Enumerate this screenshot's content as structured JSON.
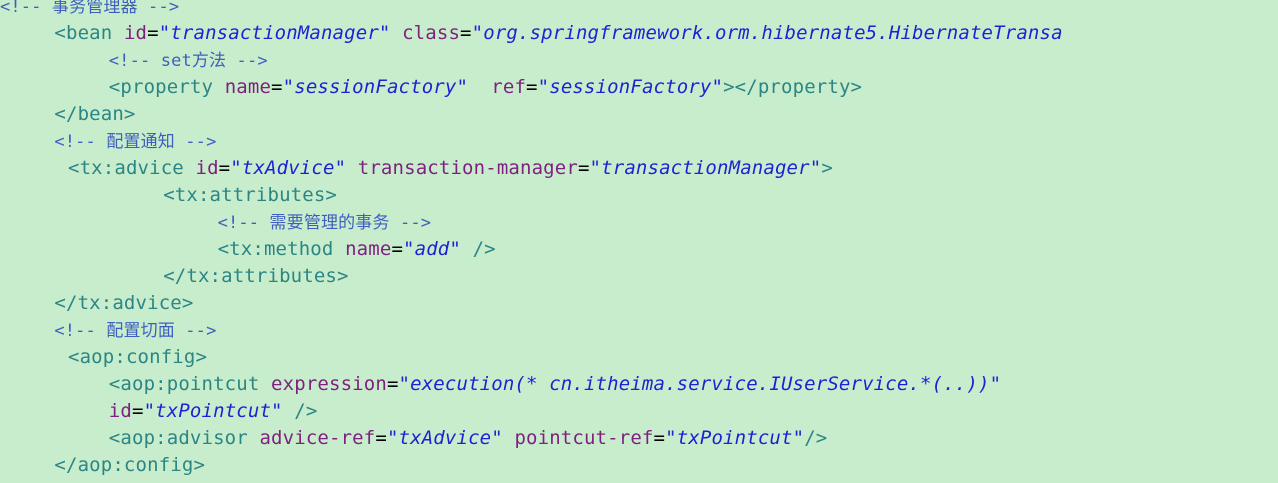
{
  "editor": {
    "lines": [
      {
        "indent": 0,
        "tokens": [
          {
            "t": "cmt",
            "v": "<!-- 事务管理器 -->"
          }
        ]
      },
      {
        "indent": 4,
        "tokens": [
          {
            "t": "tag",
            "v": "<bean "
          },
          {
            "t": "attr",
            "v": "id"
          },
          {
            "t": "eq",
            "v": "="
          },
          {
            "t": "val",
            "v": "\"transactionManager\""
          },
          {
            "t": "plain",
            "v": " "
          },
          {
            "t": "attr",
            "v": "class"
          },
          {
            "t": "eq",
            "v": "="
          },
          {
            "t": "val",
            "v": "\"org.springframework.orm.hibernate5.HibernateTransa"
          }
        ]
      },
      {
        "indent": 8,
        "tokens": [
          {
            "t": "cmt",
            "v": "<!-- set方法 -->"
          }
        ]
      },
      {
        "indent": 8,
        "tokens": [
          {
            "t": "tag",
            "v": "<property "
          },
          {
            "t": "attr",
            "v": "name"
          },
          {
            "t": "eq",
            "v": "="
          },
          {
            "t": "val",
            "v": "\"sessionFactory\""
          },
          {
            "t": "plain",
            "v": "  "
          },
          {
            "t": "attr",
            "v": "ref"
          },
          {
            "t": "eq",
            "v": "="
          },
          {
            "t": "val",
            "v": "\"sessionFactory\""
          },
          {
            "t": "tag",
            "v": "></property>"
          }
        ]
      },
      {
        "indent": 4,
        "tokens": [
          {
            "t": "tag",
            "v": "</bean>"
          }
        ]
      },
      {
        "indent": 4,
        "tokens": [
          {
            "t": "cmt",
            "v": "<!-- 配置通知 -->"
          }
        ]
      },
      {
        "indent": 5,
        "tokens": [
          {
            "t": "tag",
            "v": "<tx:advice "
          },
          {
            "t": "attr",
            "v": "id"
          },
          {
            "t": "eq",
            "v": "="
          },
          {
            "t": "val",
            "v": "\"txAdvice\""
          },
          {
            "t": "plain",
            "v": " "
          },
          {
            "t": "attr",
            "v": "transaction-manager"
          },
          {
            "t": "eq",
            "v": "="
          },
          {
            "t": "val",
            "v": "\"transactionManager\""
          },
          {
            "t": "tag",
            "v": ">"
          }
        ]
      },
      {
        "indent": 12,
        "tokens": [
          {
            "t": "tag",
            "v": "<tx:attributes>"
          }
        ]
      },
      {
        "indent": 16,
        "tokens": [
          {
            "t": "cmt",
            "v": "<!-- 需要管理的事务 -->"
          }
        ]
      },
      {
        "indent": 16,
        "tokens": [
          {
            "t": "tag",
            "v": "<tx:method "
          },
          {
            "t": "attr",
            "v": "name"
          },
          {
            "t": "eq",
            "v": "="
          },
          {
            "t": "val",
            "v": "\"add\""
          },
          {
            "t": "plain",
            "v": " "
          },
          {
            "t": "tag",
            "v": "/>"
          }
        ]
      },
      {
        "indent": 12,
        "tokens": [
          {
            "t": "tag",
            "v": "</tx:attributes>"
          }
        ]
      },
      {
        "indent": 4,
        "tokens": [
          {
            "t": "tag",
            "v": "</tx:advice>"
          }
        ]
      },
      {
        "indent": 4,
        "tokens": [
          {
            "t": "cmt",
            "v": "<!-- 配置切面 -->"
          }
        ]
      },
      {
        "indent": 5,
        "tokens": [
          {
            "t": "tag",
            "v": "<aop:config>"
          }
        ]
      },
      {
        "indent": 8,
        "tokens": [
          {
            "t": "tag",
            "v": "<aop:pointcut "
          },
          {
            "t": "attr",
            "v": "expression"
          },
          {
            "t": "eq",
            "v": "="
          },
          {
            "t": "val",
            "v": "\"execution(* cn.itheima.service.IUserService.*(..))\""
          }
        ]
      },
      {
        "indent": 8,
        "tokens": [
          {
            "t": "attr",
            "v": "id"
          },
          {
            "t": "eq",
            "v": "="
          },
          {
            "t": "val",
            "v": "\"txPointcut\""
          },
          {
            "t": "plain",
            "v": " "
          },
          {
            "t": "tag",
            "v": "/>"
          }
        ]
      },
      {
        "indent": 8,
        "tokens": [
          {
            "t": "tag",
            "v": "<aop:advisor "
          },
          {
            "t": "attr",
            "v": "advice-ref"
          },
          {
            "t": "eq",
            "v": "="
          },
          {
            "t": "val",
            "v": "\"txAdvice\""
          },
          {
            "t": "plain",
            "v": " "
          },
          {
            "t": "attr",
            "v": "pointcut-ref"
          },
          {
            "t": "eq",
            "v": "="
          },
          {
            "t": "val",
            "v": "\"txPointcut\""
          },
          {
            "t": "tag",
            "v": "/>"
          }
        ]
      },
      {
        "indent": 4,
        "tokens": [
          {
            "t": "tag",
            "v": "</aop:config>"
          }
        ]
      }
    ]
  }
}
